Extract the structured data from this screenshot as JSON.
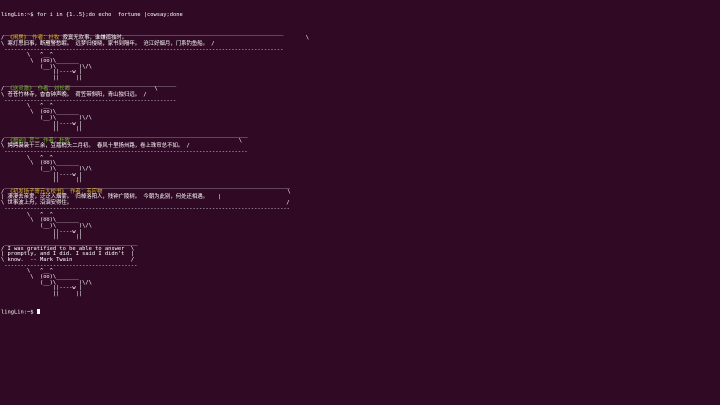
{
  "terminal": {
    "prompt": "lingLin:~$ ",
    "command": "for i in {1..5};do echo  fortune |cowsay;done",
    "final_prompt": "lingLin:~$ "
  },
  "cows": [
    {
      "top": " ______________________________________________________________________________________",
      "bubble": [
        {
          "pre": "/ ",
          "hl": "《闲居》 作者：杜牧",
          "mid": " 寂寞无欢事，谁嫌孤独时。",
          "post": "                                                       \\"
        },
        {
          "pre": "\\ ",
          "hl": "",
          "mid": "寒灯思旧事，断雁警愁眠。 远梦归侵晓，家书到隔年。 沧江好烟月，门系钓鱼船。",
          "post": " /"
        }
      ],
      "bottom": " --------------------------------------------------------------------------------------"
    },
    {
      "top": " _____________________________________________________",
      "bubble": [
        {
          "pre": "/ ",
          "hl": "《送灵澈》 作者：刘长卿",
          "mid": "",
          "post": "                          \\"
        },
        {
          "pre": "\\ ",
          "hl": "",
          "mid": "苍苍竹林寺，杳杳钟声晚。 荷笠带斜阳，青山独归远。",
          "post": " /"
        }
      ],
      "bottom": " -----------------------------------------------------"
    },
    {
      "top": " ___________________________________________________________________________",
      "bubble": [
        {
          "pre": "/ ",
          "hl": "《赠别》其二 作者：杜牧",
          "mid": "",
          "post": "                                                    \\"
        },
        {
          "pre": "\\ ",
          "hl": "",
          "mid": "娉娉袅袅十三余，豆蔻梢头二月初。 春风十里扬州路，卷上珠帘总不如。",
          "post": " /"
        }
      ],
      "bottom": " ---------------------------------------------------------------------------"
    },
    {
      "top": " ________________________________________________________________________________________",
      "bubble": [
        {
          "pre": "/ ",
          "hl": "《初发扬子寄元大校书》 作者：韦应物",
          "mid": "",
          "post": "                                                         \\"
        },
        {
          "pre": "| ",
          "hl": "",
          "mid": "凄凄去亲爱，泛泛入烟雾。 归棹洛阳人，残钟广陵树。 今朝为此别，何处还相遇。",
          "post": "   |"
        },
        {
          "pre": "\\ ",
          "hl": "",
          "mid": "世事波上舟，沿洄安得住。",
          "post": "                                                                  /"
        }
      ],
      "bottom": " ----------------------------------------------------------------------------------------"
    },
    {
      "top": " _________________________________________",
      "bubble": [
        {
          "pre": "/ ",
          "hl": "",
          "mid": "I was gratified to be able to answer",
          "post": "  \\"
        },
        {
          "pre": "| ",
          "hl": "",
          "mid": "promptly, and I did. I said I didn't",
          "post": "  |"
        },
        {
          "pre": "\\ ",
          "hl": "",
          "mid": "know.  -- Mark Twain",
          "post": "                  /"
        }
      ],
      "bottom": " -----------------------------------------"
    }
  ],
  "cow_art": [
    "        \\   ^__^",
    "         \\  (oo)\\_______",
    "            (__)\\       )\\/\\",
    "                ||----w |",
    "                ||     ||"
  ]
}
